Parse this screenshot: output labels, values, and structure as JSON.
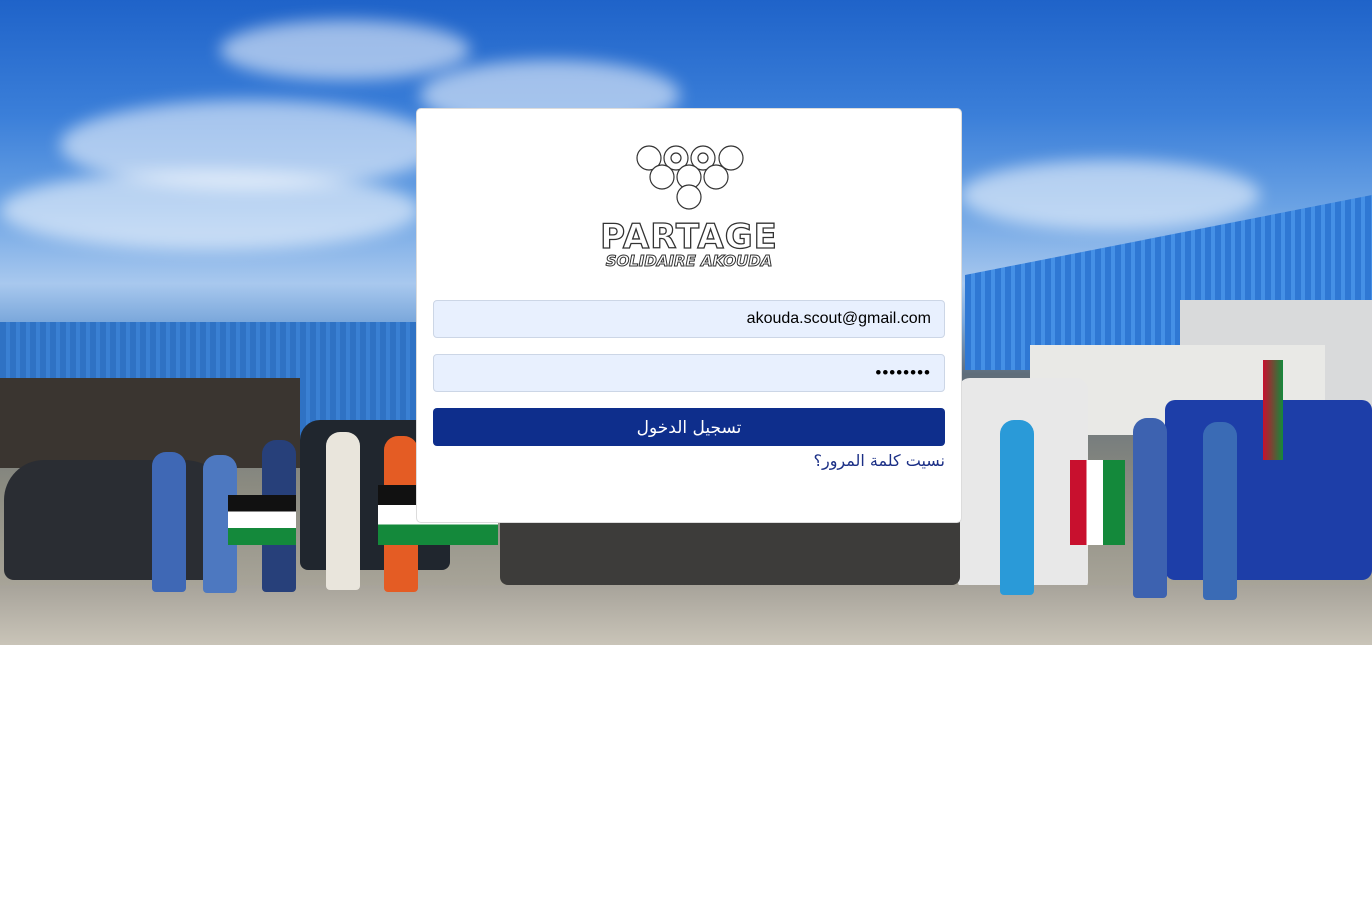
{
  "brand": {
    "name_line1": "PARTAGE",
    "name_line2": "SOLIDAIRE AKOUDA"
  },
  "login": {
    "email_value": "akouda.scout@gmail.com",
    "password_value": "••••••••",
    "submit_label": "تسجيل الدخول",
    "forgot_label": "نسيت كلمة المرور؟"
  },
  "colors": {
    "primary_button": "#0e2e8c",
    "input_background": "#e8f0fe",
    "link": "#1b2f86"
  }
}
